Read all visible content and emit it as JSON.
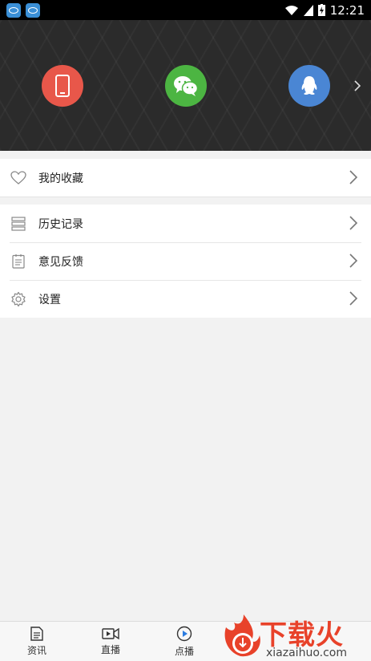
{
  "status_bar": {
    "time": "12:21"
  },
  "header": {
    "login_options": [
      "phone-login",
      "wechat-login",
      "qq-login"
    ]
  },
  "favorites": {
    "label": "我的收藏"
  },
  "menu": [
    {
      "label": "历史记录",
      "icon": "history-icon"
    },
    {
      "label": "意见反馈",
      "icon": "feedback-icon"
    },
    {
      "label": "设置",
      "icon": "settings-icon"
    }
  ],
  "tabbar": {
    "tabs": [
      {
        "label": "资讯",
        "icon": "news-icon"
      },
      {
        "label": "直播",
        "icon": "live-icon"
      },
      {
        "label": "点播",
        "icon": "vod-icon"
      }
    ]
  },
  "watermark": {
    "brand": "下载火",
    "url": "xiazaihuo.com"
  },
  "colors": {
    "phone": "#e8574a",
    "wechat": "#4cb542",
    "qq": "#4a86d4",
    "brand": "#e8422a"
  }
}
